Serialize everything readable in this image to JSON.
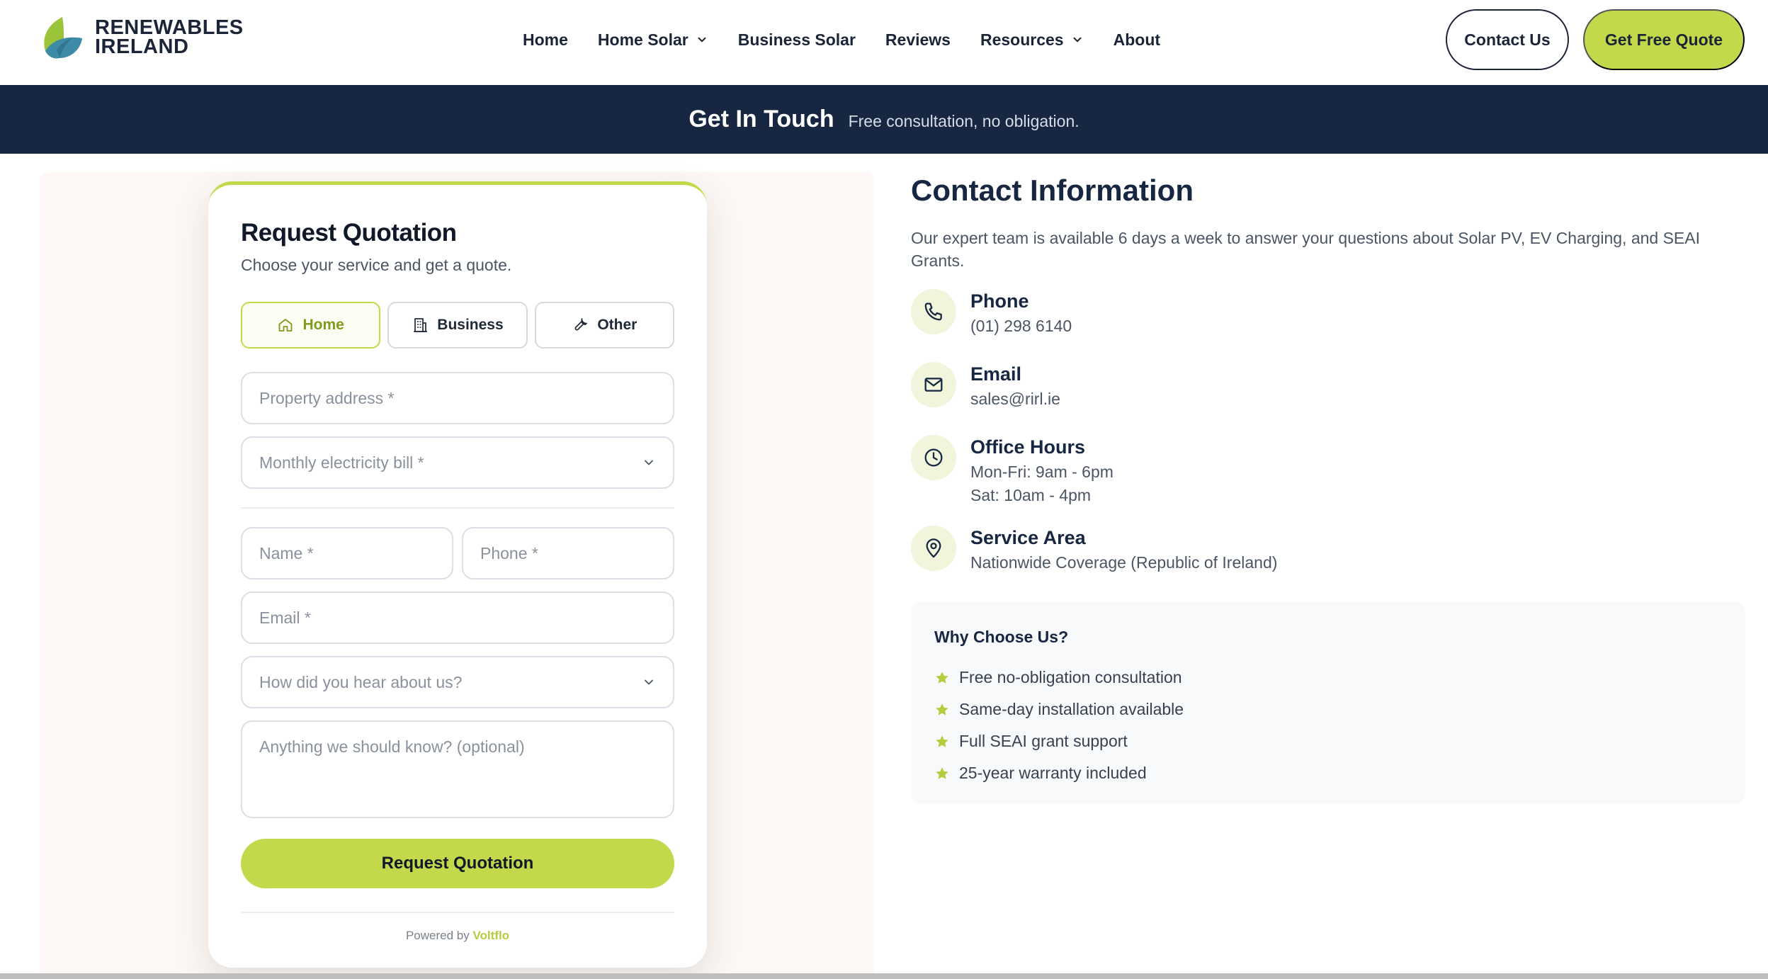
{
  "brand": {
    "line1": "RENEWABLES",
    "line2": "IRELAND"
  },
  "nav": {
    "items": [
      {
        "label": "Home",
        "dropdown": false
      },
      {
        "label": "Home Solar",
        "dropdown": true
      },
      {
        "label": "Business Solar",
        "dropdown": false
      },
      {
        "label": "Reviews",
        "dropdown": false
      },
      {
        "label": "Resources",
        "dropdown": true
      },
      {
        "label": "About",
        "dropdown": false
      }
    ],
    "contact_label": "Contact Us",
    "quote_label": "Get Free Quote"
  },
  "banner": {
    "title": "Get In Touch",
    "subtitle": "Free consultation, no obligation."
  },
  "form": {
    "title": "Request Quotation",
    "subtitle": "Choose your service and get a quote.",
    "service_tabs": [
      {
        "label": "Home",
        "icon": "home-icon",
        "active": true
      },
      {
        "label": "Business",
        "icon": "building-icon",
        "active": false
      },
      {
        "label": "Other",
        "icon": "wrench-icon",
        "active": false
      }
    ],
    "address_placeholder": "Property address *",
    "bill_placeholder": "Monthly electricity bill *",
    "name_placeholder": "Name *",
    "phone_placeholder": "Phone *",
    "email_placeholder": "Email *",
    "source_placeholder": "How did you hear about us?",
    "notes_placeholder": "Anything we should know? (optional)",
    "submit_label": "Request Quotation",
    "powered_prefix": "Powered by",
    "powered_brand": "Voltflo"
  },
  "contact": {
    "title": "Contact Information",
    "description": "Our expert team is available 6 days a week to answer your questions about Solar PV, EV Charging, and SEAI Grants.",
    "phone": {
      "label": "Phone",
      "value": "(01) 298 6140",
      "icon": "phone-icon"
    },
    "email": {
      "label": "Email",
      "value": "sales@rirl.ie",
      "icon": "mail-icon"
    },
    "hours": {
      "label": "Office Hours",
      "line1": "Mon-Fri: 9am - 6pm",
      "line2": "Sat: 10am - 4pm",
      "icon": "clock-icon"
    },
    "area": {
      "label": "Service Area",
      "value": "Nationwide Coverage (Republic of Ireland)",
      "icon": "map-pin-icon"
    }
  },
  "why": {
    "title": "Why Choose Us?",
    "items": [
      "Free no-obligation consultation",
      "Same-day installation available",
      "Full SEAI grant support",
      "25-year warranty included"
    ]
  },
  "colors": {
    "accent": "#c3d94b",
    "navy": "#172641",
    "panel": "#fdf8f5"
  }
}
